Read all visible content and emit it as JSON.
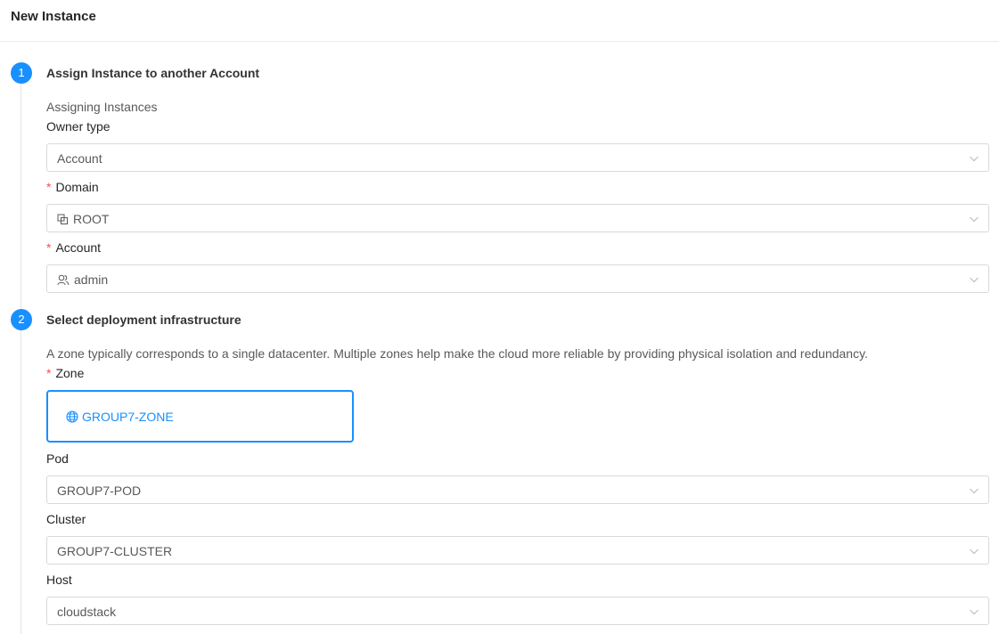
{
  "header": {
    "title": "New Instance"
  },
  "step1": {
    "number": "1",
    "title": "Assign Instance to another Account",
    "description": "Assigning Instances",
    "owner_type": {
      "label": "Owner type",
      "value": "Account"
    },
    "domain": {
      "required_mark": "*",
      "label": "Domain",
      "value": "ROOT"
    },
    "account": {
      "required_mark": "*",
      "label": "Account",
      "value": "admin"
    }
  },
  "step2": {
    "number": "2",
    "title": "Select deployment infrastructure",
    "description": "A zone typically corresponds to a single datacenter. Multiple zones help make the cloud more reliable by providing physical isolation and redundancy.",
    "zone": {
      "required_mark": "*",
      "label": "Zone",
      "value": "GROUP7-ZONE"
    },
    "pod": {
      "label": "Pod",
      "value": "GROUP7-POD"
    },
    "cluster": {
      "label": "Cluster",
      "value": "GROUP7-CLUSTER"
    },
    "host": {
      "label": "Host",
      "value": "cloudstack"
    }
  },
  "colors": {
    "accent": "#1890ff",
    "required": "#ff4d4f",
    "border": "#d9d9d9"
  },
  "icons": {
    "domain": "copy-blocks-icon",
    "account": "team-icon",
    "zone": "globe-icon",
    "select": "chevron-down-icon"
  }
}
